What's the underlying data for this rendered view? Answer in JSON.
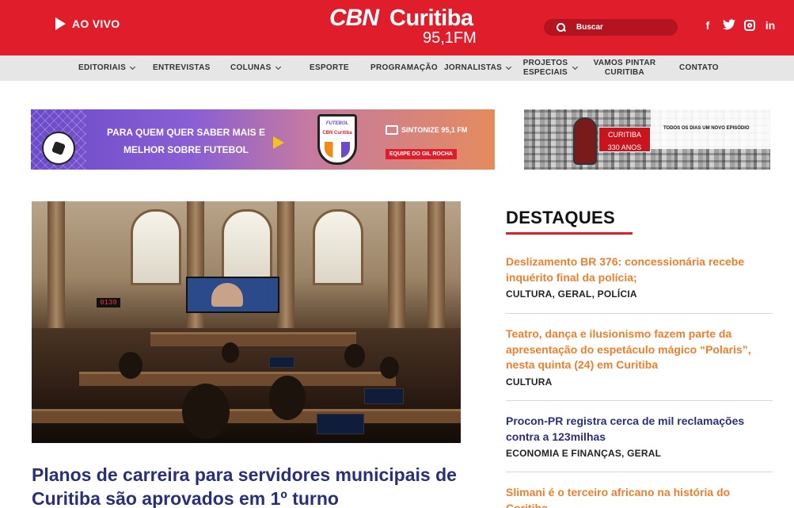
{
  "header": {
    "live_label": "AO VIVO",
    "logo_cbn": "CBN",
    "logo_city": "Curitiba",
    "logo_freq": "95,1FM",
    "search_placeholder": "Buscar",
    "social": [
      "facebook-icon",
      "twitter-icon",
      "instagram-icon",
      "linkedin-icon"
    ],
    "colors": {
      "brand_red": "#e01e2b",
      "nav_bg": "#e6e6e6"
    }
  },
  "nav": {
    "items": [
      {
        "label": "EDITORIAIS",
        "dropdown": true
      },
      {
        "label": "ENTREVISTAS",
        "dropdown": false
      },
      {
        "label": "COLUNAS",
        "dropdown": true
      },
      {
        "label": "ESPORTE",
        "dropdown": false
      },
      {
        "label": "PROGRAMAÇÃO",
        "dropdown": false
      },
      {
        "label": "JORNALISTAS",
        "dropdown": true
      },
      {
        "label": "PROJETOS ESPECIAIS",
        "dropdown": true
      },
      {
        "label": "VAMOS PINTAR CURITIBA",
        "dropdown": false
      },
      {
        "label": "CONTATO",
        "dropdown": false
      }
    ]
  },
  "banners": {
    "futebol": {
      "headline_1": "PARA QUEM QUER SABER MAIS E",
      "headline_2": "MELHOR SOBRE FUTEBOL",
      "badge_tag": "FUTEBOL",
      "badge_brand": "CBN Curitiba",
      "tune": "SINTONIZE 95,1 FM",
      "team": "EQUIPE DO GIL ROCHA"
    },
    "curitiba330": {
      "label_1": "CURITIBA",
      "label_2": "330 ANOS",
      "slogan": "TODOS OS DIAS UM NOVO EPISÓDIO"
    }
  },
  "featured": {
    "image_timer": "0139",
    "title": "Planos de carreira para servidores municipais de Curitiba são aprovados em 1º turno",
    "title_color": "#2a2f7a"
  },
  "destaques": {
    "heading": "DESTAQUES",
    "items": [
      {
        "title": "Deslizamento BR 376: concessionária recebe inquérito final da polícia;",
        "color": "#ee7f2d",
        "categories": [
          "CULTURA",
          "GERAL",
          "POLÍCIA"
        ]
      },
      {
        "title": "Teatro, dança e ilusionismo fazem parte da apresentação do espetáculo mágico “Polaris”, nesta quinta (24) em Curitiba",
        "color": "#ee7f2d",
        "categories": [
          "CULTURA"
        ]
      },
      {
        "title": "Procon-PR registra cerca de mil reclamações contra a 123milhas",
        "color": "#2a2f7a",
        "categories": [
          "ECONOMIA E FINANÇAS",
          "GERAL"
        ]
      },
      {
        "title": "Slimani é o terceiro africano na história do Coritiba",
        "color": "#ee7f2d",
        "categories": []
      }
    ]
  }
}
